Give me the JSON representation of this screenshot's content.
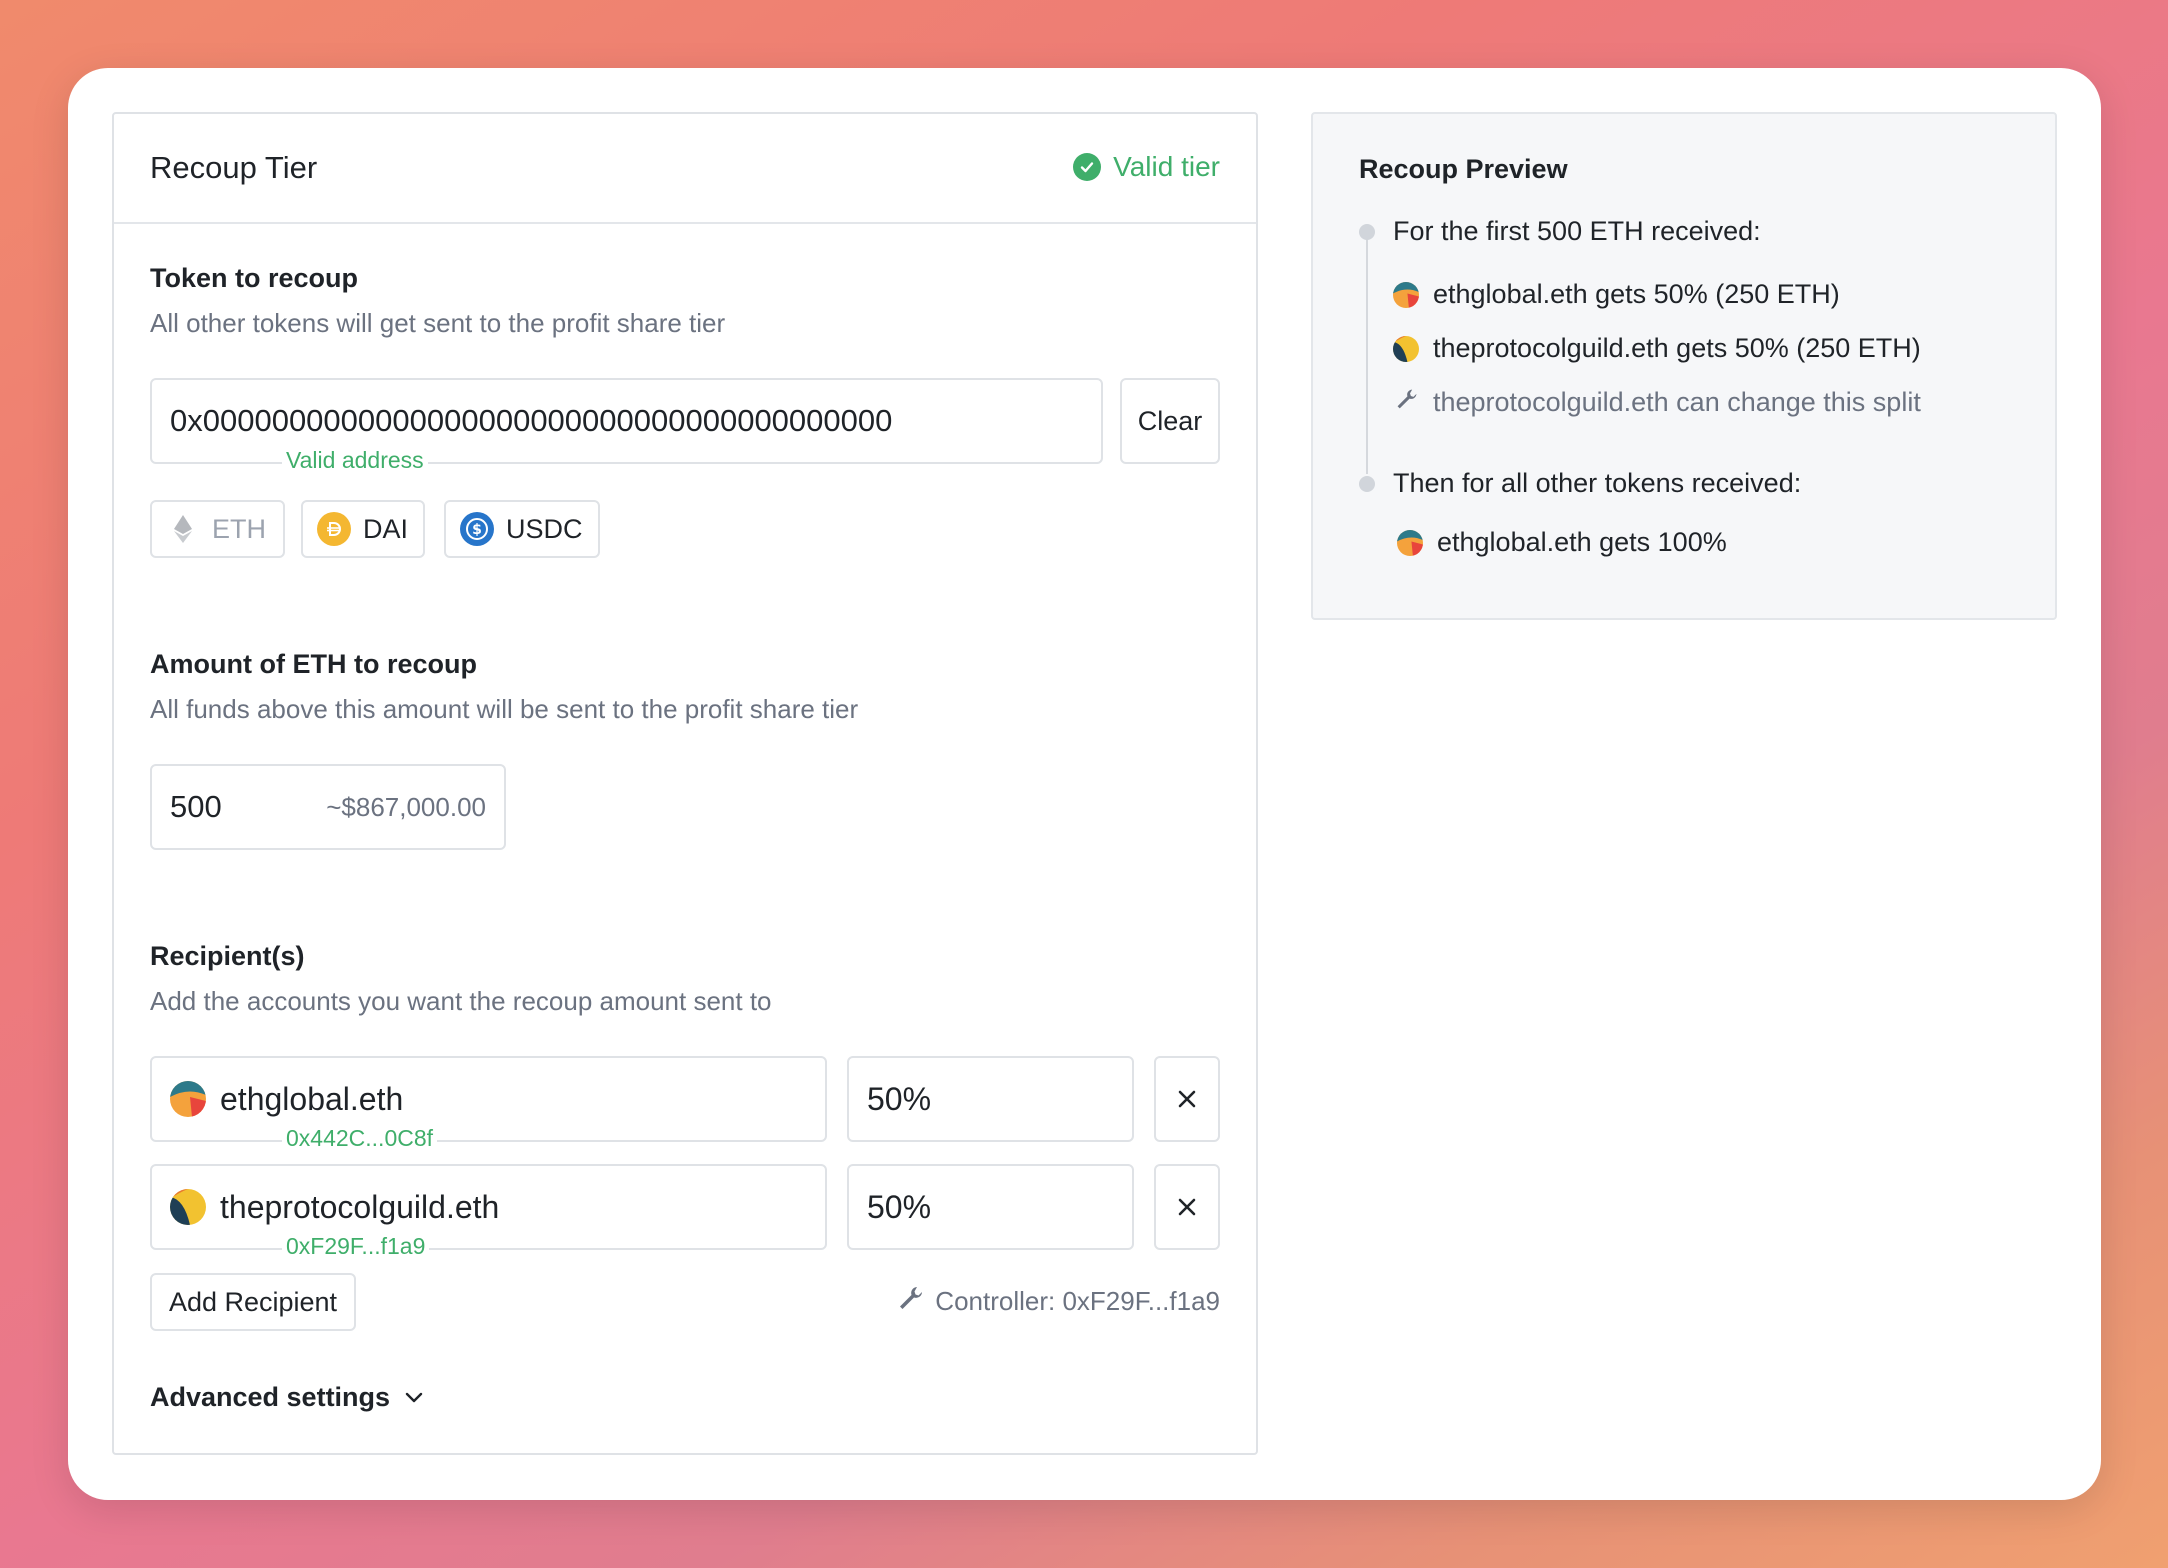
{
  "tier": {
    "title": "Recoup Tier",
    "status": "Valid tier",
    "token_section": {
      "label": "Token to recoup",
      "description": "All other tokens will get sent to the profit share tier",
      "address_value": "0x0000000000000000000000000000000000000000",
      "clear_label": "Clear",
      "valid_hint": "Valid address",
      "tokens": [
        {
          "symbol": "ETH",
          "icon": "eth-icon",
          "selected": true
        },
        {
          "symbol": "DAI",
          "icon": "dai-icon",
          "selected": false
        },
        {
          "symbol": "USDC",
          "icon": "usdc-icon",
          "selected": false
        }
      ]
    },
    "amount_section": {
      "label": "Amount of ETH to recoup",
      "description": "All funds above this amount will be sent to the profit share tier",
      "value": "500",
      "usd_estimate": "~$867,000.00"
    },
    "recipients_section": {
      "label": "Recipient(s)",
      "description": "Add the accounts you want the recoup amount sent to",
      "recipients": [
        {
          "name": "ethglobal.eth",
          "address": "0x442C...0C8f",
          "percent": "50%"
        },
        {
          "name": "theprotocolguild.eth",
          "address": "0xF29F...f1a9",
          "percent": "50%"
        }
      ],
      "add_label": "Add Recipient",
      "controller": "Controller: 0xF29F...f1a9"
    },
    "advanced_label": "Advanced settings"
  },
  "preview": {
    "title": "Recoup Preview",
    "first_heading": "For the first 500 ETH received:",
    "first_lines": [
      "ethglobal.eth gets 50% (250 ETH)",
      "theprotocolguild.eth gets 50% (250 ETH)"
    ],
    "change_note": "theprotocolguild.eth can change this split",
    "then_heading": "Then for all other tokens received:",
    "then_line": "ethglobal.eth gets 100%"
  },
  "colors": {
    "valid_green": "#3fae6a",
    "border": "#dfe2e6",
    "muted_text": "#6b7280"
  }
}
